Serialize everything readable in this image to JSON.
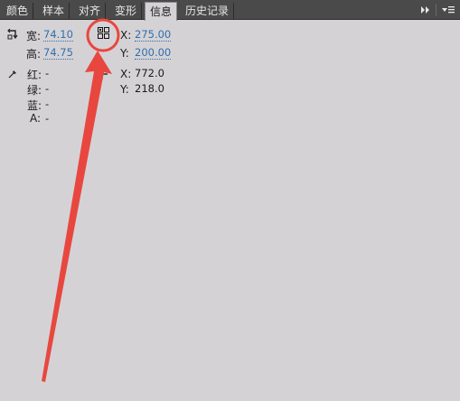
{
  "tabs": [
    {
      "label": "颜色"
    },
    {
      "label": "样本"
    },
    {
      "label": "对齐"
    },
    {
      "label": "变形"
    },
    {
      "label": "信息",
      "active": true
    },
    {
      "label": "历史记录"
    }
  ],
  "panel_controls": {
    "collapse_icon": "double-arrow-right-icon",
    "menu_icon": "panel-menu-icon"
  },
  "size": {
    "width_label": "宽:",
    "width_value": "74.10",
    "height_label": "高:",
    "height_value": "74.75"
  },
  "position": {
    "x_label": "X:",
    "x_value": "275.00",
    "y_label": "Y:",
    "y_value": "200.00"
  },
  "color": {
    "r_label": "红:",
    "r_value": "-",
    "g_label": "绿:",
    "g_value": "-",
    "b_label": "蓝:",
    "b_value": "-",
    "a_label": "A:",
    "a_value": "-"
  },
  "cursor": {
    "x_label": "X:",
    "x_value": "772.0",
    "y_label": "Y:",
    "y_value": "218.0"
  },
  "colors": {
    "tab_bg": "#4a4a4a",
    "panel_bg": "#d5d2d5",
    "link_value": "#2e6fb0",
    "annotation": "#e8473f"
  }
}
